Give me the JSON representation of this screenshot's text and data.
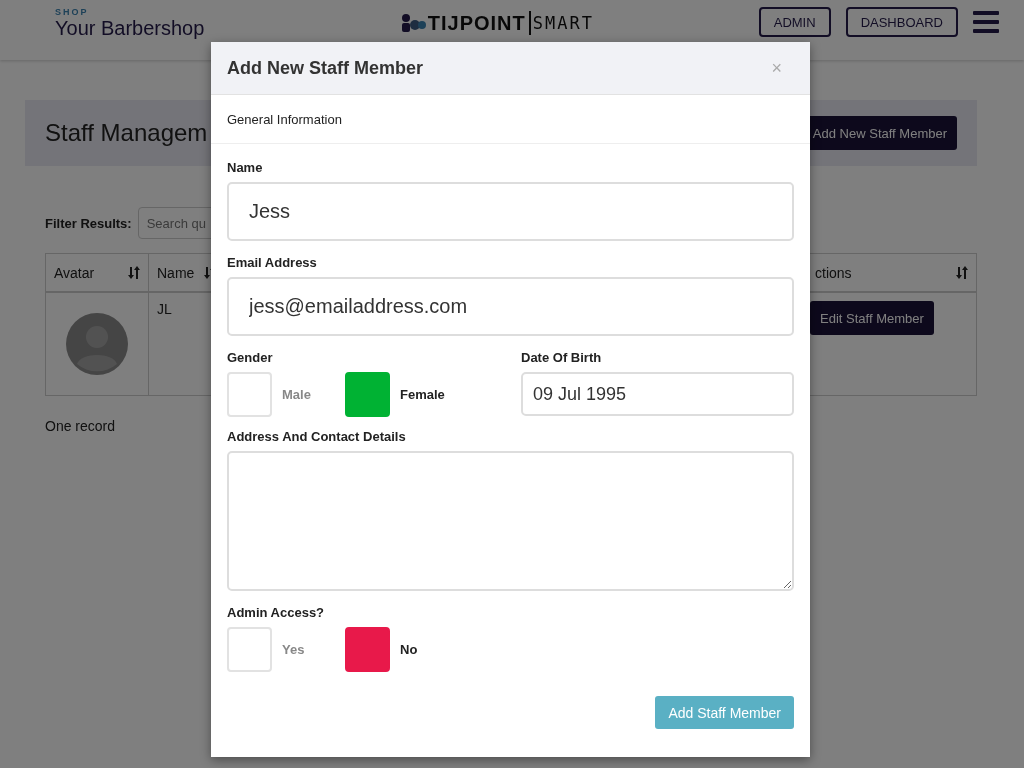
{
  "header": {
    "shop_label": "SHOP",
    "shop_name": "Your Barbershop",
    "logo": {
      "main": "TIJPOINT",
      "sub": "SMART"
    },
    "buttons": [
      "ADMIN",
      "DASHBOARD"
    ]
  },
  "page": {
    "title": "Staff Managem",
    "add_button": "Add New Staff Member",
    "filter_label": "Filter Results:",
    "search_placeholder": "Search qu",
    "table": {
      "columns": [
        {
          "label": "Avatar"
        },
        {
          "label": "Name"
        },
        {
          "label": "ctions"
        }
      ],
      "rows": [
        {
          "name": "JL",
          "action": "Edit Staff Member"
        }
      ]
    },
    "record_count": "One record"
  },
  "modal": {
    "title": "Add New Staff Member",
    "close": "×",
    "section": "General Information",
    "name": {
      "label": "Name",
      "value": "Jess"
    },
    "email": {
      "label": "Email Address",
      "value": "jess@emailaddress.com"
    },
    "gender": {
      "label": "Gender",
      "color": "#00b233",
      "options": [
        {
          "label": "Male",
          "selected": false
        },
        {
          "label": "Female",
          "selected": true
        }
      ]
    },
    "dob": {
      "label": "Date Of Birth",
      "value": "09 Jul 1995"
    },
    "address": {
      "label": "Address And Contact Details"
    },
    "admin": {
      "label": "Admin Access?",
      "color": "#e8194a",
      "options": [
        {
          "label": "Yes",
          "selected": false
        },
        {
          "label": "No",
          "selected": true
        }
      ]
    },
    "submit": "Add Staff Member"
  }
}
